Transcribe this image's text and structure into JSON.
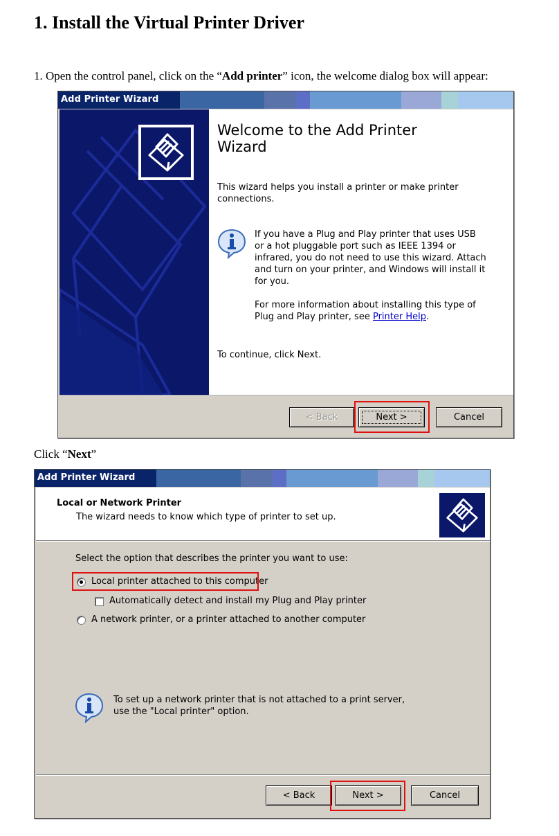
{
  "doc": {
    "heading": "1. Install the Virtual Printer Driver",
    "step1_prefix": "1. Open the control panel, click on the “",
    "step1_bold": "Add printer",
    "step1_suffix": "” icon, the welcome dialog box will appear:",
    "click_prefix": "Click “",
    "click_bold": "Next",
    "click_suffix": "”"
  },
  "dialog1": {
    "title": "Add Printer Wizard",
    "welcome_line1": "Welcome to the Add Printer",
    "welcome_line2": "Wizard",
    "intro_line1": "This wizard helps you install a printer or make printer",
    "intro_line2": "connections.",
    "pnp_lines": [
      "If you have a Plug and Play printer that uses USB",
      "or a hot pluggable port such as IEEE 1394 or",
      "infrared, you do not need to use this wizard. Attach",
      "and turn on your printer, and Windows will install it",
      "for you."
    ],
    "more_line1": "For more information about installing this type of",
    "more_line2_prefix": "Plug and Play printer, see ",
    "more_link": "Printer Help",
    "more_line2_suffix": ".",
    "continue_text": "To continue, click Next.",
    "back_label": "< Back",
    "next_label": "Next >",
    "cancel_label": "Cancel"
  },
  "dialog2": {
    "title": "Add Printer Wizard",
    "header_title": "Local or Network Printer",
    "header_subtitle": "The wizard needs to know which type of printer to set up.",
    "prompt": "Select the option that describes the printer you want to use:",
    "option_local": "Local printer attached to this computer",
    "option_autodetect": "Automatically detect and install my Plug and Play printer",
    "option_network": "A network printer, or a printer attached to another computer",
    "selected_option": "Local printer attached to this computer",
    "autodetect_checked": false,
    "info_line1": "To set up a network printer that is not attached to a print server,",
    "info_line2": "use the \"Local printer\" option.",
    "back_label": "< Back",
    "next_label": "Next >",
    "cancel_label": "Cancel"
  },
  "colors": {
    "titlebar_dark": "#0a246a",
    "sidebar": "#0b1769",
    "dialog_face": "#d4d0c8",
    "highlight_box": "#e01010",
    "link": "#0000c8"
  },
  "icons": [
    "printer-icon",
    "info-icon"
  ]
}
